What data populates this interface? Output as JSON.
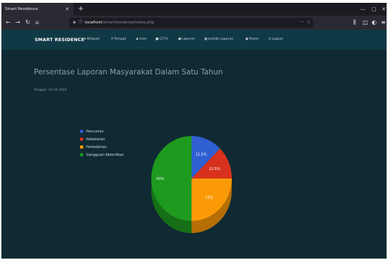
{
  "browser": {
    "tab_title": "Smart Residence",
    "url_host": "localhost",
    "url_path": "/smartresidence/index.php"
  },
  "navbar": {
    "brand": "SMART RESIDENCE",
    "items": [
      {
        "label": "Wilayah",
        "icon": "map-icon"
      },
      {
        "label": "Tempat",
        "icon": "pin-icon"
      },
      {
        "label": "User",
        "icon": "user-icon"
      },
      {
        "label": "CCTV",
        "icon": "camera-icon"
      },
      {
        "label": "Laporan",
        "icon": "report-icon"
      },
      {
        "label": "Jumlah Laporan",
        "icon": "table-icon"
      },
      {
        "label": "Pesan",
        "icon": "message-icon"
      },
      {
        "label": "Logout",
        "icon": "logout-icon"
      }
    ]
  },
  "page": {
    "title": "Persentase Laporan Masyarakat Dalam Satu Tahun",
    "date": "Tanggal: 18-06-2020"
  },
  "chart_data": {
    "type": "pie",
    "categories": [
      "Pencurian",
      "Kebakaran",
      "Perkelahian",
      "Gangguan Ketertiban"
    ],
    "values": [
      12.5,
      12.5,
      25,
      50
    ],
    "labels": [
      "12.5%",
      "12.5%",
      "25%",
      "50%"
    ],
    "colors": [
      "#2f5fd0",
      "#d8321e",
      "#fb9a06",
      "#1e9a1e"
    ],
    "title": "",
    "legend_position": "left"
  }
}
